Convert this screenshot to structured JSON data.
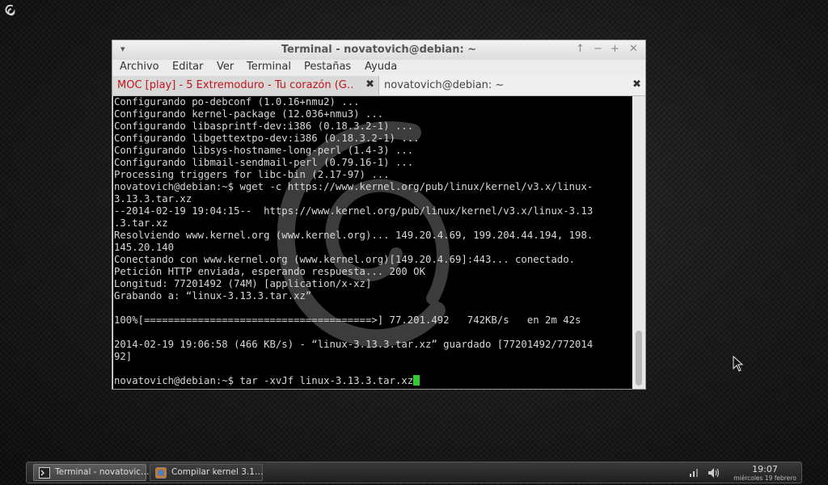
{
  "window": {
    "title": "Terminal - novatovich@debian: ~",
    "controls": {
      "menu": "▾",
      "up": "↑",
      "minimize": "−",
      "maximize": "+",
      "close": "✕"
    }
  },
  "menubar": [
    "Archivo",
    "Editar",
    "Ver",
    "Terminal",
    "Pestañas",
    "Ayuda"
  ],
  "tabs": [
    {
      "label": "MOC [play] - 5 Extremoduro - Tu corazón (G…",
      "close": "✖"
    },
    {
      "label": "novatovich@debian: ~",
      "close": "✖"
    }
  ],
  "terminal": {
    "output": "Configurando po-debconf (1.0.16+nmu2) ...\nConfigurando kernel-package (12.036+nmu3) ...\nConfigurando libasprintf-dev:i386 (0.18.3.2-1) ...\nConfigurando libgettextpo-dev:i386 (0.18.3.2-1) ...\nConfigurando libsys-hostname-long-perl (1.4-3) ...\nConfigurando libmail-sendmail-perl (0.79.16-1) ...\nProcessing triggers for libc-bin (2.17-97) ...\nnovatovich@debian:~$ wget -c https://www.kernel.org/pub/linux/kernel/v3.x/linux-\n3.13.3.tar.xz\n--2014-02-19 19:04:15--  https://www.kernel.org/pub/linux/kernel/v3.x/linux-3.13\n.3.tar.xz\nResolviendo www.kernel.org (www.kernel.org)... 149.20.4.69, 199.204.44.194, 198.\n145.20.140\nConectando con www.kernel.org (www.kernel.org)[149.20.4.69]:443... conectado.\nPetición HTTP enviada, esperando respuesta... 200 OK\nLongitud: 77201492 (74M) [application/x-xz]\nGrabando a: “linux-3.13.3.tar.xz”\n\n100%[======================================>] 77.201.492   742KB/s   en 2m 42s\n\n2014-02-19 19:06:58 (466 KB/s) - “linux-3.13.3.tar.xz” guardado [77201492/772014\n92]\n\n",
    "prompt_line": "novatovich@debian:~$ tar -xvJf linux-3.13.3.tar.xz",
    "cursor_color": "#2ecc2e"
  },
  "taskbar": {
    "tasks": [
      {
        "label": "Terminal - novatovic…",
        "icon": "terminal-icon",
        "active": true
      },
      {
        "label": "Compilar kernel 3.1…",
        "icon": "browser-icon",
        "active": false
      }
    ],
    "clock": {
      "time": "19:07",
      "date": "miércoles 19 febrero"
    }
  },
  "colors": {
    "tab_playing_text": "#c0151b",
    "terminal_bg": "#000000",
    "terminal_fg": "#d8d8d8"
  }
}
